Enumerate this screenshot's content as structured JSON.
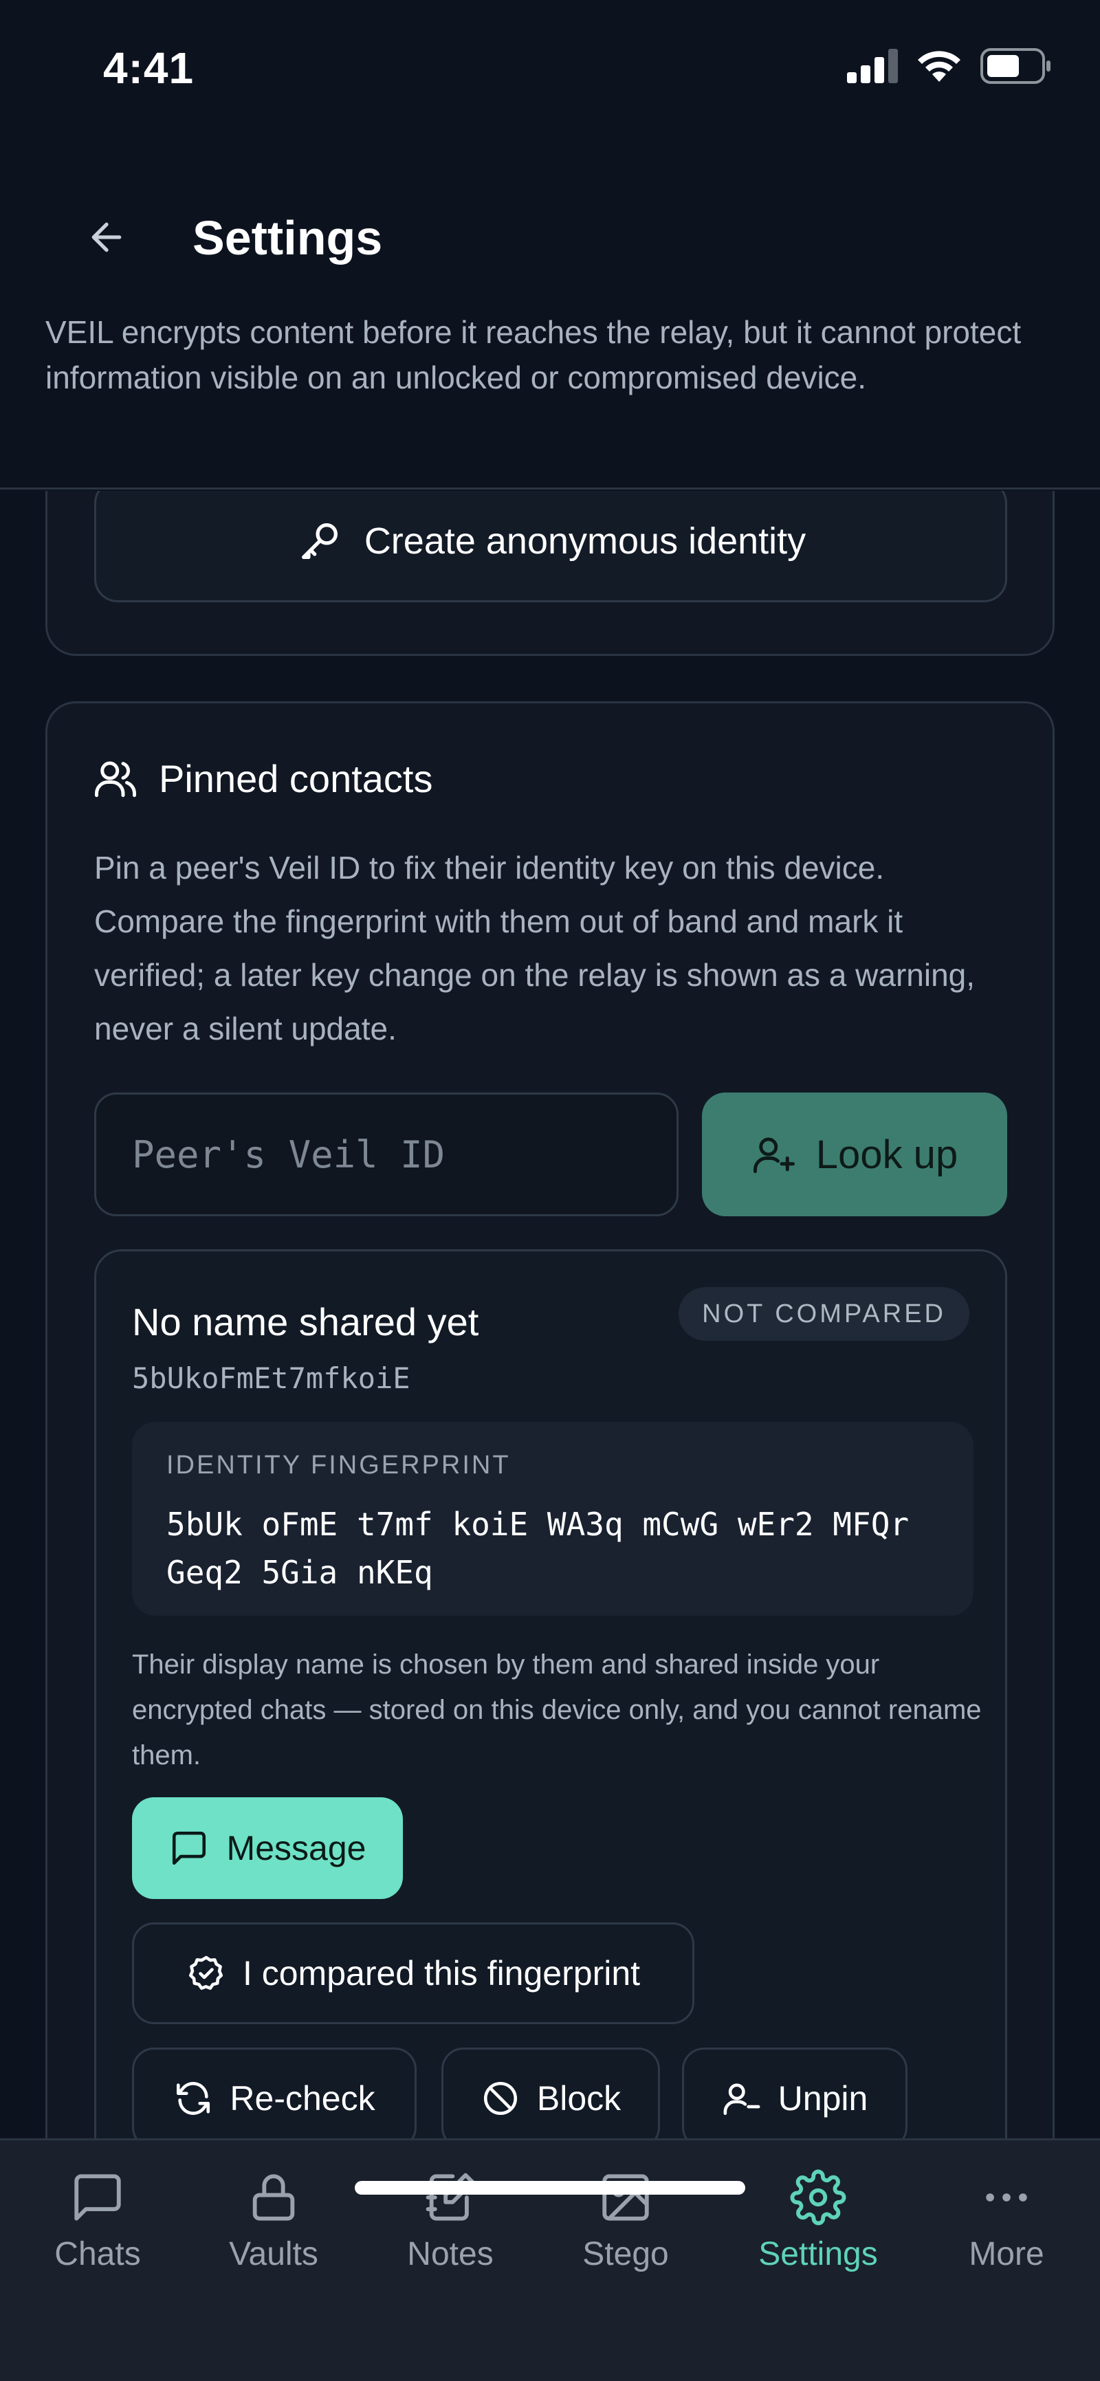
{
  "status_bar": {
    "time": "4:41"
  },
  "header": {
    "title": "Settings",
    "notice": "VEIL encrypts content before it reaches the relay, but it cannot protect information visible on an unlocked or compromised device."
  },
  "identity": {
    "create_label": "Create anonymous identity"
  },
  "pinned": {
    "title": "Pinned contacts",
    "description": "Pin a peer's Veil ID to fix their identity key on this device. Compare the fingerprint with them out of band and mark it verified; a later key change on the relay is shown as a warning, never a silent update.",
    "input_placeholder": "Peer's Veil ID",
    "input_value": "",
    "lookup_label": "Look up",
    "contact": {
      "name": "No name shared yet",
      "veil_id": "5bUkoFmEt7mfkoiE",
      "status": "NOT COMPARED",
      "fingerprint_label": "IDENTITY FINGERPRINT",
      "fingerprint": "5bUk oFmE t7mf koiE WA3q mCwG wEr2 MFQr Geq2 5Gia nKEq",
      "note": "Their display name is chosen by them and shared inside your encrypted chats — stored on this device only, and you cannot rename them.",
      "message_label": "Message",
      "compared_label": "I compared this fingerprint",
      "recheck_label": "Re-check",
      "block_label": "Block",
      "unpin_label": "Unpin"
    }
  },
  "tabs": [
    {
      "label": "Chats",
      "icon": "chat-icon"
    },
    {
      "label": "Vaults",
      "icon": "lock-icon"
    },
    {
      "label": "Notes",
      "icon": "notebook-icon"
    },
    {
      "label": "Stego",
      "icon": "image-icon"
    },
    {
      "label": "Settings",
      "icon": "gear-icon",
      "active": true
    },
    {
      "label": "More",
      "icon": "more-icon"
    }
  ],
  "colors": {
    "background": "#0d131e",
    "accent": "#6ee1c6",
    "accent_dim": "#3d7d6f",
    "active_tab": "#5fd3b8"
  }
}
